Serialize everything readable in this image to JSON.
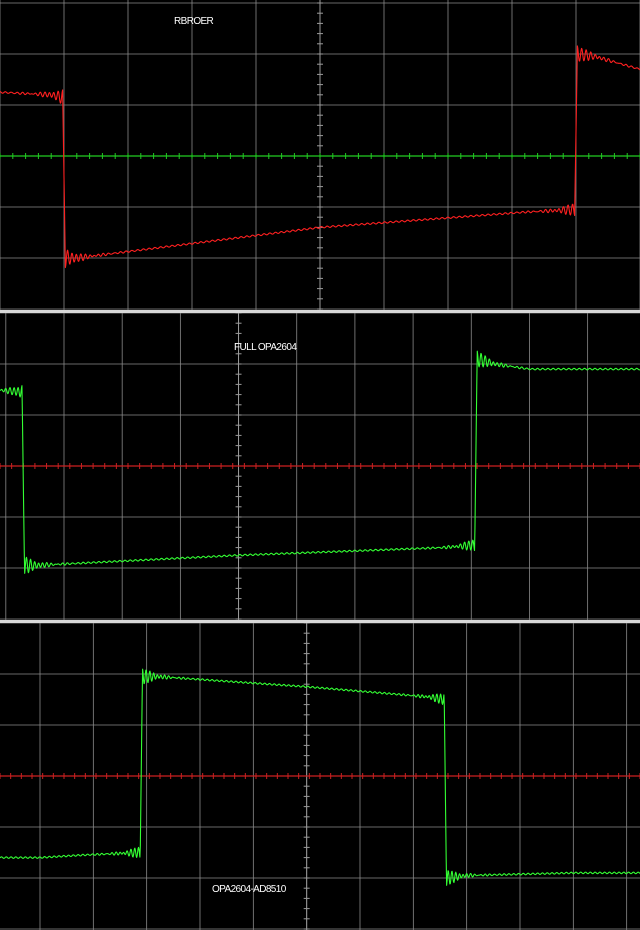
{
  "chart_data": [
    {
      "type": "line",
      "title": "RBROER",
      "x": [
        -5.0,
        -4.2,
        -4.02,
        -3.98,
        -3.8,
        0.0,
        3.2,
        3.98,
        4.02,
        4.3,
        5.0
      ],
      "series": [
        {
          "values": [
            1.25,
            1.2,
            1.15,
            -2.0,
            -2.0,
            -1.4,
            -1.1,
            -1.05,
            2.0,
            1.95,
            1.7
          ]
        }
      ],
      "xlim": [
        -5,
        5
      ],
      "ylim": [
        -3,
        3
      ],
      "grid": true,
      "colors": {
        "trace": "#ff2020",
        "axis": "#22cc22",
        "grid": "#8a8a8a"
      }
    },
    {
      "type": "line",
      "title": "FULL OPA2604",
      "x": [
        -5.0,
        -4.2,
        -3.72,
        -3.68,
        -3.5,
        0.0,
        3.5,
        4.06,
        4.1,
        4.4,
        5.0
      ],
      "series": [
        {
          "values": [
            1.6,
            1.5,
            1.45,
            -1.95,
            -1.95,
            -1.75,
            -1.6,
            -1.55,
            2.1,
            2.0,
            1.9
          ]
        }
      ],
      "xlim": [
        -4.1,
        6.9
      ],
      "ylim": [
        -3,
        3
      ],
      "grid": true,
      "colors": {
        "trace": "#33ff33",
        "axis": "#cc2020",
        "grid": "#8a8a8a"
      }
    },
    {
      "type": "line",
      "title": "OPA2604-AD8510",
      "x": [
        -5.0,
        -4.2,
        -3.12,
        -3.08,
        -2.8,
        0.0,
        2.3,
        2.58,
        2.62,
        3.0,
        5.0
      ],
      "series": [
        {
          "values": [
            -1.6,
            -1.55,
            -1.5,
            1.95,
            1.95,
            1.75,
            1.55,
            1.5,
            -2.0,
            -1.95,
            -1.9
          ]
        }
      ],
      "xlim": [
        -5.75,
        6.25
      ],
      "ylim": [
        -3,
        3
      ],
      "grid": true,
      "colors": {
        "trace": "#33ff33",
        "axis": "#cc2020",
        "grid": "#8a8a8a"
      }
    }
  ]
}
